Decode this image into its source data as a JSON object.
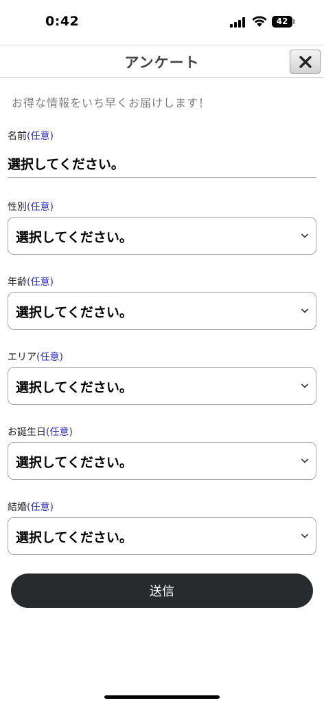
{
  "status_bar": {
    "time": "0:42",
    "battery": "42"
  },
  "header": {
    "title": "アンケート",
    "close_icon": "close-icon"
  },
  "subtitle": "お得な情報をいち早くお届けします！",
  "optional_tag": "(任意)",
  "fields": [
    {
      "label": "名前",
      "value": "選択してください。",
      "type": "text"
    },
    {
      "label": "性別",
      "value": "選択してください。",
      "type": "select"
    },
    {
      "label": "年齢",
      "value": "選択してください。",
      "type": "select"
    },
    {
      "label": "エリア",
      "value": "選択してください。",
      "type": "select"
    },
    {
      "label": "お誕生日",
      "value": "選択してください。",
      "type": "select"
    },
    {
      "label": "結婚",
      "value": "選択してください。",
      "type": "select"
    }
  ],
  "submit_label": "送信",
  "colors": {
    "optional": "#2b2bd1",
    "submit_bg": "#272b2e",
    "subtitle": "#7d7d7d"
  }
}
